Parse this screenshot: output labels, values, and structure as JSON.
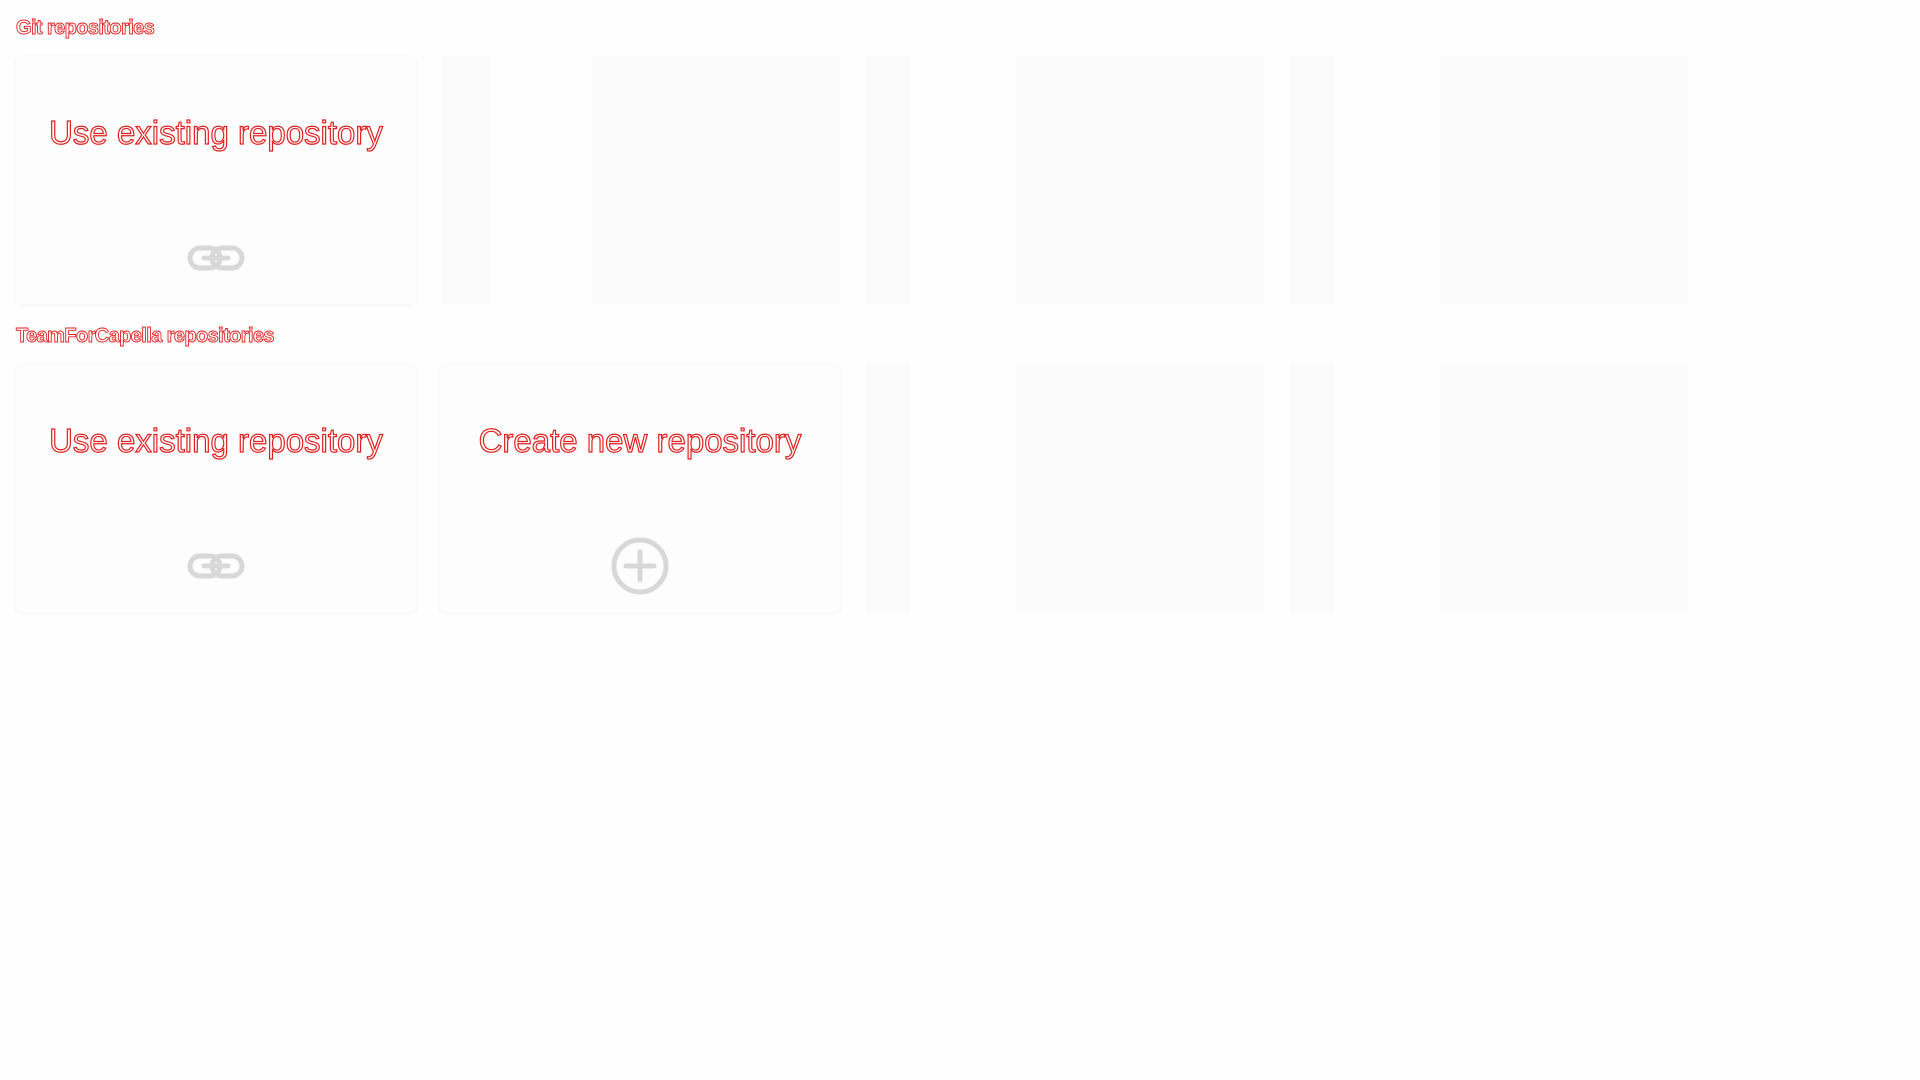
{
  "sections": [
    {
      "title": "Git repositories",
      "tiles": [
        {
          "label": "Use existing repository",
          "icon": "link-icon"
        }
      ]
    },
    {
      "title": "TeamForCapella repositories",
      "tiles": [
        {
          "label": "Use existing repository",
          "icon": "link-icon"
        },
        {
          "label": "Create new repository",
          "icon": "add-circle-icon"
        }
      ]
    }
  ],
  "colors": {
    "text_outline": "#e02020",
    "icon": "#d8d8d8",
    "tile_bg": "#fdfdfd",
    "ghost_bg": "#fbfbfb"
  }
}
